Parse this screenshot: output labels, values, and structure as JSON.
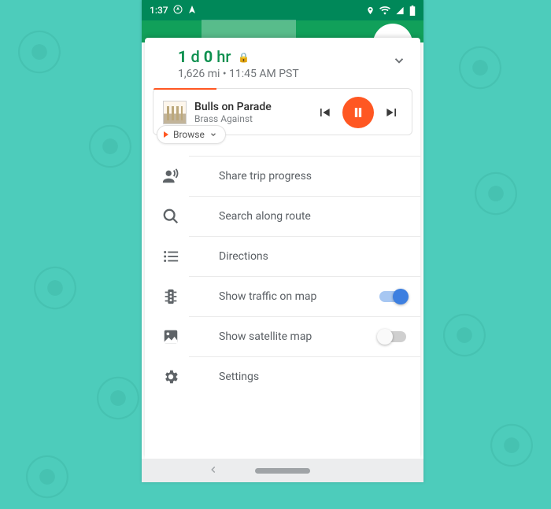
{
  "statusbar": {
    "time": "1:37"
  },
  "eta": {
    "d_num": "1",
    "d_unit": "d",
    "h_num": "0",
    "h_unit": "hr",
    "subtitle": "1,626 mi  •  11:45 AM PST"
  },
  "media": {
    "title": "Bulls on Parade",
    "artist": "Brass Against",
    "browse": "Browse"
  },
  "options": {
    "share": "Share trip progress",
    "search": "Search along route",
    "directions": "Directions",
    "traffic": "Show traffic on map",
    "satellite": "Show satellite map",
    "settings": "Settings",
    "traffic_on": true,
    "satellite_on": false
  }
}
